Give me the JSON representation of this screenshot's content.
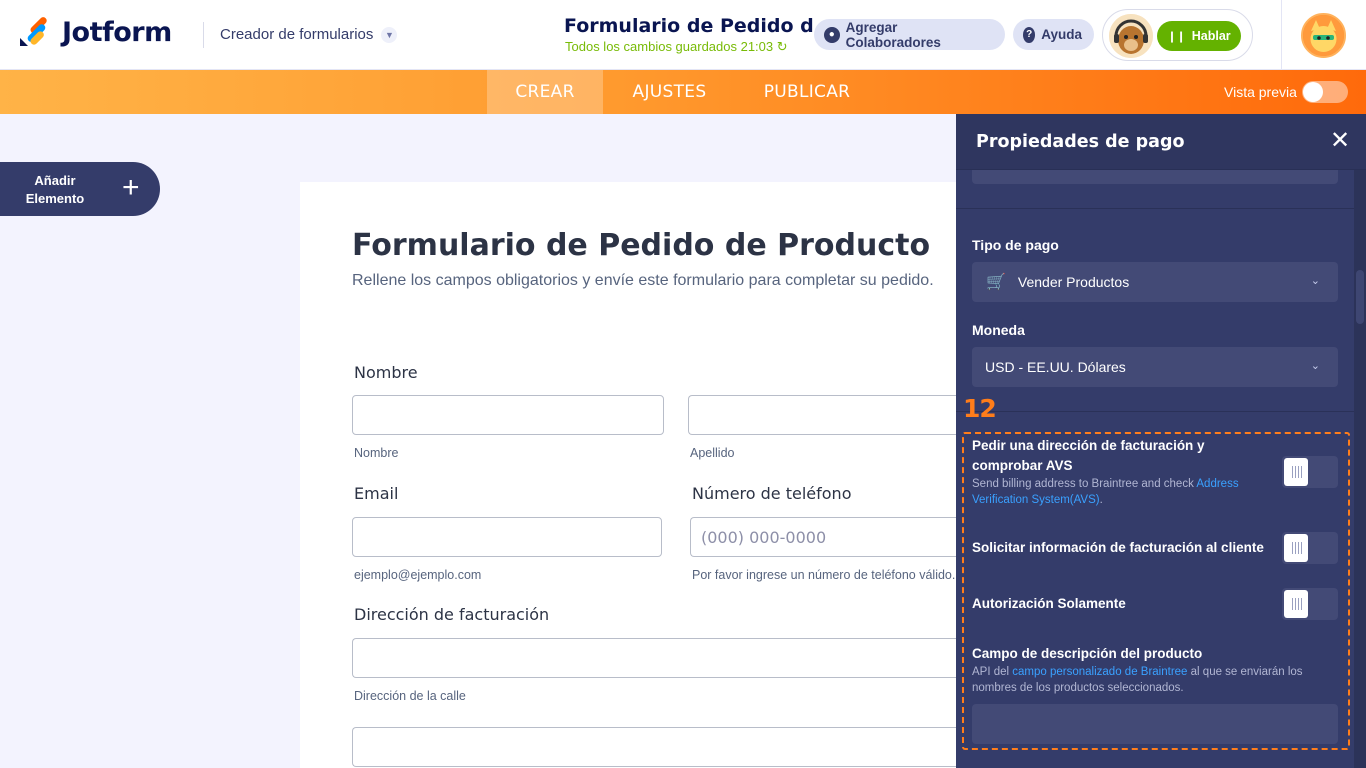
{
  "header": {
    "logo_text": "Jotform",
    "builder_label": "Creador de formularios",
    "form_title": "Formulario de Pedido d...",
    "saved_status": "Todos los cambios guardados 21:03",
    "collaborators_label": "Agregar Colaboradores",
    "help_label": "Ayuda",
    "talk_label": "Hablar"
  },
  "nav": {
    "tabs": [
      {
        "label": "CREAR",
        "active": true
      },
      {
        "label": "AJUSTES",
        "active": false
      },
      {
        "label": "PUBLICAR",
        "active": false
      }
    ],
    "preview_label": "Vista previa",
    "preview_on": false
  },
  "add_element": {
    "line1": "Añadir",
    "line2": "Elemento"
  },
  "form": {
    "title": "Formulario de Pedido de Producto",
    "subtitle": "Rellene los campos obligatorios y envíe este formulario para completar su pedido.",
    "name_label": "Nombre",
    "first_hint": "Nombre",
    "last_hint": "Apellido",
    "email_label": "Email",
    "email_hint": "ejemplo@ejemplo.com",
    "phone_label": "Número de teléfono",
    "phone_placeholder": "(000) 000-0000",
    "phone_hint": "Por favor ingrese un número de teléfono válido.",
    "address_label": "Dirección de facturación",
    "street_hint": "Dirección de la calle"
  },
  "panel": {
    "title": "Propiedades de pago",
    "payment_type_label": "Tipo de pago",
    "payment_type_value": "Vender Productos",
    "currency_label": "Moneda",
    "currency_value": "USD - EE.UU. Dólares",
    "step_number": "12",
    "options": [
      {
        "title": "Pedir una dirección de facturación y comprobar AVS",
        "desc_prefix": "Send billing address to Braintree and check ",
        "desc_link": "Address Verification System(AVS)",
        "desc_suffix": ".",
        "enabled": false
      },
      {
        "title": "Solicitar información de facturación al cliente",
        "enabled": false
      },
      {
        "title": "Autorización Solamente",
        "enabled": false
      }
    ],
    "desc_field": {
      "title": "Campo de descripción del producto",
      "desc_prefix": "API del ",
      "desc_link": "campo personalizado de Braintree",
      "desc_suffix": " al que se enviarán los nombres de los productos seleccionados.",
      "value": ""
    }
  },
  "colors": {
    "brand_dark": "#0a1551",
    "accent_orange": "#ff6100",
    "panel_bg": "#343c6a",
    "success_green": "#64b200",
    "link_blue": "#3aa1ff"
  }
}
